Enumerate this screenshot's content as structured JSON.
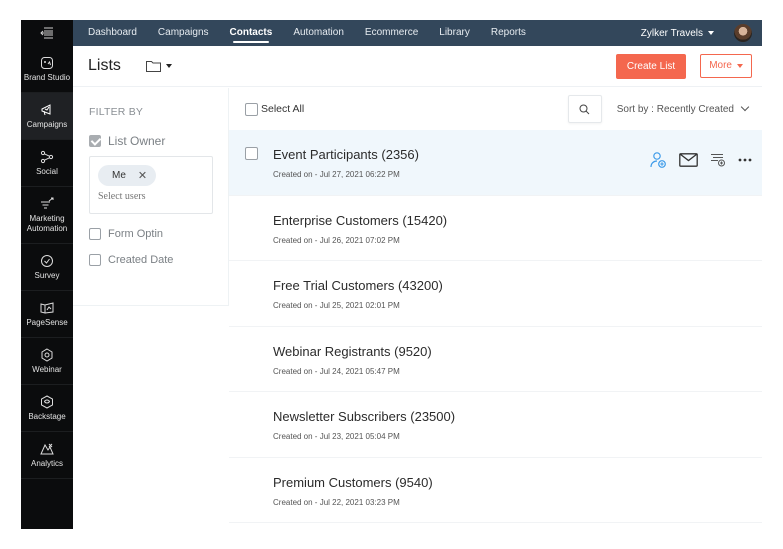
{
  "rail": {
    "items": [
      {
        "label": "Brand Studio",
        "icon": "brand-studio-icon"
      },
      {
        "label": "Campaigns",
        "icon": "megaphone-icon",
        "active": true
      },
      {
        "label": "Social",
        "icon": "share-icon"
      },
      {
        "label": "Marketing Automation",
        "icon": "funnel-icon"
      },
      {
        "label": "Survey",
        "icon": "check-circle-icon"
      },
      {
        "label": "PageSense",
        "icon": "pagesense-icon"
      },
      {
        "label": "Webinar",
        "icon": "webinar-icon"
      },
      {
        "label": "Backstage",
        "icon": "backstage-icon"
      },
      {
        "label": "Analytics",
        "icon": "analytics-icon"
      }
    ]
  },
  "topnav": {
    "items": [
      "Dashboard",
      "Campaigns",
      "Contacts",
      "Automation",
      "Ecommerce",
      "Library",
      "Reports"
    ],
    "active": "Contacts",
    "org_name": "Zylker Travels"
  },
  "header": {
    "title": "Lists",
    "create_label": "Create List",
    "more_label": "More"
  },
  "filter": {
    "title": "FILTER BY",
    "list_owner_label": "List Owner",
    "list_owner_checked": true,
    "owner_chip": "Me",
    "owner_placeholder": "Select users",
    "form_optin_label": "Form Optin",
    "created_date_label": "Created Date"
  },
  "toolbar": {
    "select_all_label": "Select All",
    "sort_label": "Sort by : Recently Created"
  },
  "lists": [
    {
      "name": "Event Participants (2356)",
      "created": "Created on - Jul 27, 2021 06:22 PM"
    },
    {
      "name": "Enterprise Customers (15420)",
      "created": "Created on - Jul 26, 2021 07:02 PM"
    },
    {
      "name": "Free Trial Customers (43200)",
      "created": "Created on - Jul 25, 2021 02:01 PM"
    },
    {
      "name": "Webinar Registrants (9520)",
      "created": "Created on - Jul 24, 2021 05:47 PM"
    },
    {
      "name": "Newsletter Subscribers (23500)",
      "created": "Created on - Jul 23, 2021 05:04 PM"
    },
    {
      "name": "Premium Customers (9540)",
      "created": "Created on - Jul 22, 2021 03:23 PM"
    }
  ],
  "colors": {
    "nav_bg": "#33475b",
    "rail_bg": "#0b0c0d",
    "accent": "#f4674e",
    "add_contact_icon": "#3d9be9",
    "hover_row": "#f0f7fc"
  }
}
